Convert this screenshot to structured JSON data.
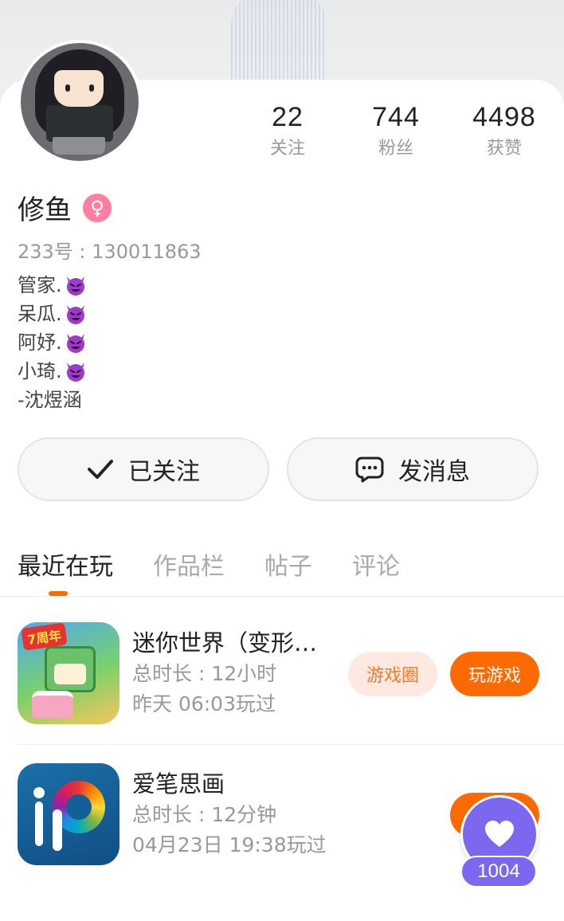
{
  "profile": {
    "name": "修鱼",
    "gender_icon": "female-symbol-icon",
    "uid": "233号 : 130011863",
    "bio_lines": [
      "管家.",
      "呆瓜.",
      "阿妤.",
      "小琦.",
      "-沈煜涵"
    ],
    "bio_emoji": "smiling-devil-emoji"
  },
  "stats": {
    "following": {
      "value": "22",
      "label": "关注"
    },
    "fans": {
      "value": "744",
      "label": "粉丝"
    },
    "likes": {
      "value": "4498",
      "label": "获赞"
    }
  },
  "actions": {
    "follow_label": "已关注",
    "message_label": "发消息"
  },
  "tabs": [
    {
      "label": "最近在玩",
      "active": true
    },
    {
      "label": "作品栏",
      "active": false
    },
    {
      "label": "帖子",
      "active": false
    },
    {
      "label": "评论",
      "active": false
    }
  ],
  "games": [
    {
      "title": "迷你世界（变形金…",
      "duration": "总时长 : 12小时",
      "last_played": "昨天 06:03玩过",
      "icon_badge": "7周年",
      "circle_label": "游戏圈",
      "play_label": "玩游戏"
    },
    {
      "title": "爱笔思画",
      "duration": "总时长 : 12分钟",
      "last_played": "04月23日 19:38玩过"
    }
  ],
  "floating_like": {
    "count": "1004",
    "icon": "heart-icon"
  },
  "colors": {
    "accent": "#ff6a00",
    "accent_light": "#fde9df",
    "gender_badge": "#ff7fa0",
    "like_bubble": "#7b68ee"
  }
}
